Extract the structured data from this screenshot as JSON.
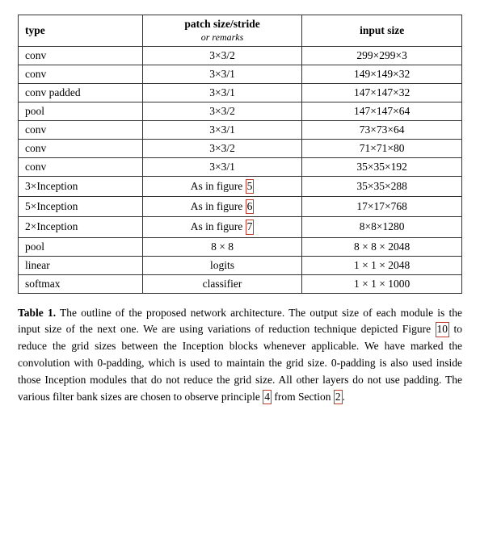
{
  "table": {
    "headers": {
      "type": "type",
      "patch": "patch size/stride",
      "patch_sub": "or remarks",
      "input": "input size"
    },
    "rows": [
      {
        "type": "conv",
        "patch": "3×3/2",
        "input": "299×299×3",
        "highlight_patch": false
      },
      {
        "type": "conv",
        "patch": "3×3/1",
        "input": "149×149×32",
        "highlight_patch": false
      },
      {
        "type": "conv padded",
        "patch": "3×3/1",
        "input": "147×147×32",
        "highlight_patch": false
      },
      {
        "type": "pool",
        "patch": "3×3/2",
        "input": "147×147×64",
        "highlight_patch": false
      },
      {
        "type": "conv",
        "patch": "3×3/1",
        "input": "73×73×64",
        "highlight_patch": false
      },
      {
        "type": "conv",
        "patch": "3×3/2",
        "input": "71×71×80",
        "highlight_patch": false
      },
      {
        "type": "conv",
        "patch": "3×3/1",
        "input": "35×35×192",
        "highlight_patch": false
      },
      {
        "type": "3×Inception",
        "patch": "As in figure 5",
        "input": "35×35×288",
        "highlight_patch": true
      },
      {
        "type": "5×Inception",
        "patch": "As in figure 6",
        "input": "17×17×768",
        "highlight_patch": true
      },
      {
        "type": "2×Inception",
        "patch": "As in figure 7",
        "input": "8×8×1280",
        "highlight_patch": true
      },
      {
        "type": "pool",
        "patch": "8 × 8",
        "input": "8 × 8 × 2048",
        "highlight_patch": false
      },
      {
        "type": "linear",
        "patch": "logits",
        "input": "1 × 1 × 2048",
        "highlight_patch": false
      },
      {
        "type": "softmax",
        "patch": "classifier",
        "input": "1 × 1 × 1000",
        "highlight_patch": false
      }
    ]
  },
  "caption": {
    "label": "Table 1.",
    "text": " The outline of the proposed network architecture. The output size of each module is the input size of the next one. We are using variations of reduction technique depicted Figure ",
    "ref_10": "10",
    "text2": " to reduce the grid sizes between the Inception blocks whenever applicable. We have marked the convolution with 0-padding, which is used to maintain the grid size. 0-padding is also used inside those Inception modules that do not reduce the grid size. All other layers do not use padding. The various filter bank sizes are chosen to observe principle ",
    "ref_4": "4",
    "text3": " from Section ",
    "ref_2": "2",
    "text4": "."
  }
}
